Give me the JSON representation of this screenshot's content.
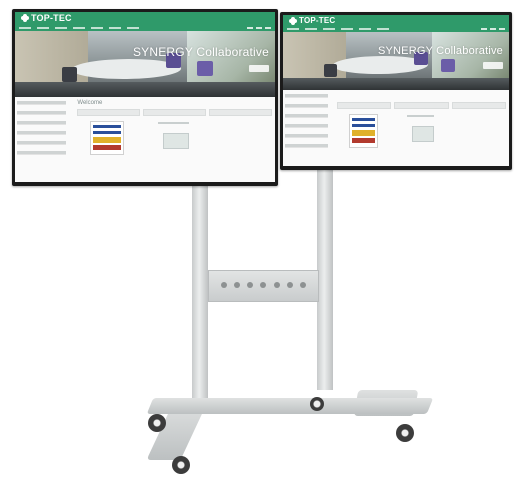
{
  "screens": [
    {
      "logo": "TOP-TEC",
      "hero_title": "SYNERGY Collaborative",
      "welcome": "Welcome"
    },
    {
      "logo": "TOP-TEC",
      "hero_title": "SYNERGY Collaborative",
      "welcome": ""
    }
  ],
  "colors": {
    "brand_green": "#2f9a6a",
    "stand_metal": "#d6d9da",
    "bezel": "#1b1b1b"
  }
}
